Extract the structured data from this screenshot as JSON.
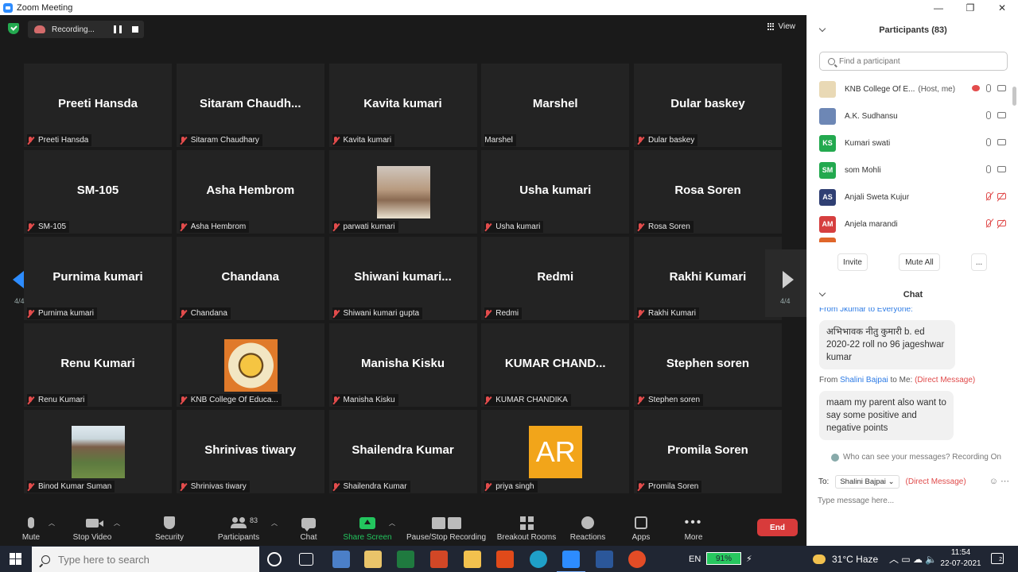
{
  "window": {
    "title": "Zoom Meeting",
    "controls": [
      "—",
      "❐",
      "✕"
    ]
  },
  "meeting": {
    "recording_label": "Recording...",
    "view_label": "View",
    "page_indicator_left": "4/4",
    "page_indicator_right": "4/4",
    "tiles": [
      {
        "big": "Preeti Hansda",
        "name": "Preeti Hansda",
        "muted": true
      },
      {
        "big": "Sitaram  Chaudh...",
        "name": "Sitaram Chaudhary",
        "muted": true
      },
      {
        "big": "Kavita kumari",
        "name": "Kavita kumari",
        "muted": true
      },
      {
        "big": "Marshel",
        "name": "Marshel",
        "muted": false
      },
      {
        "big": "Dular baskey",
        "name": "Dular baskey",
        "muted": true
      },
      {
        "big": "SM-105",
        "name": "SM-105",
        "muted": true
      },
      {
        "big": "Asha Hembrom",
        "name": "Asha Hembrom",
        "muted": true
      },
      {
        "big": "",
        "name": "parwati kumari",
        "muted": true,
        "photo": "boy"
      },
      {
        "big": "Usha kumari",
        "name": "Usha kumari",
        "muted": true
      },
      {
        "big": "Rosa Soren",
        "name": "Rosa Soren",
        "muted": true
      },
      {
        "big": "Purnima kumari",
        "name": "Purnima kumari",
        "muted": true
      },
      {
        "big": "Chandana",
        "name": "Chandana",
        "muted": true
      },
      {
        "big": "Shiwani  kumari...",
        "name": "Shiwani kumari gupta",
        "muted": true
      },
      {
        "big": "Redmi",
        "name": "Redmi",
        "muted": true
      },
      {
        "big": "Rakhi Kumari",
        "name": "Rakhi Kumari",
        "muted": true
      },
      {
        "big": "Renu Kumari",
        "name": "Renu Kumari",
        "muted": true
      },
      {
        "big": "",
        "name": "KNB College Of Educa...",
        "muted": true,
        "photo": "college"
      },
      {
        "big": "Manisha Kisku",
        "name": "Manisha Kisku",
        "muted": true
      },
      {
        "big": "KUMAR  CHAND...",
        "name": "KUMAR CHANDIKA",
        "muted": true
      },
      {
        "big": "Stephen soren",
        "name": "Stephen soren",
        "muted": true
      },
      {
        "big": "",
        "name": "Binod Kumar Suman",
        "muted": true,
        "photo": "man"
      },
      {
        "big": "Shrinivas tiwary",
        "name": "Shrinivas tiwary",
        "muted": true
      },
      {
        "big": "Shailendra Kumar",
        "name": "Shailendra Kumar",
        "muted": true
      },
      {
        "big": "",
        "name": "priya singh",
        "muted": true,
        "photo": "ar",
        "photo_text": "AR"
      },
      {
        "big": "Promila Soren",
        "name": "Promila Soren",
        "muted": true
      }
    ]
  },
  "toolbar": {
    "mute": "Mute",
    "stop_video": "Stop Video",
    "security": "Security",
    "participants": "Participants",
    "participants_count": "83",
    "chat": "Chat",
    "share_screen": "Share Screen",
    "pause_stop_recording": "Pause/Stop Recording",
    "breakout_rooms": "Breakout Rooms",
    "reactions": "Reactions",
    "apps": "Apps",
    "more": "More",
    "end": "End"
  },
  "participants_panel": {
    "title": "Participants (83)",
    "search_placeholder": "Find a participant",
    "rows": [
      {
        "initials": "",
        "color": "#e9d9b5",
        "name": "KNB College Of E...",
        "tag": "(Host, me)",
        "mic": "on",
        "cam": "on",
        "rec": true
      },
      {
        "initials": "",
        "color": "#6d87b5",
        "name": "A.K. Sudhansu",
        "tag": "",
        "mic": "on",
        "cam": "on",
        "rec": false
      },
      {
        "initials": "KS",
        "color": "#23a94f",
        "name": "Kumari swati",
        "tag": "",
        "mic": "on",
        "cam": "on",
        "rec": false
      },
      {
        "initials": "SM",
        "color": "#23a94f",
        "name": "som Mohli",
        "tag": "",
        "mic": "on",
        "cam": "on",
        "rec": false
      },
      {
        "initials": "AS",
        "color": "#2f3f73",
        "name": "Anjali Sweta Kujur",
        "tag": "",
        "mic": "off",
        "cam": "off",
        "rec": false
      },
      {
        "initials": "AM",
        "color": "#d63f3f",
        "name": "Anjela marandi",
        "tag": "",
        "mic": "off",
        "cam": "off",
        "rec": false
      }
    ],
    "invite": "Invite",
    "mute_all": "Mute All",
    "more": "..."
  },
  "chat_panel": {
    "title": "Chat",
    "partial_from": "From Jkumar to Everyone:",
    "msg1": "अभिभावक नीतु कुमारी b. ed 2020-22 roll no 96  jageshwar kumar",
    "from2_prefix": "From",
    "from2_user": "Shalini Bajpai",
    "from2_to": "to Me:",
    "from2_dm": "(Direct Message)",
    "msg2": "maam my parent also want to say some positive and negative points",
    "who_can_see": "Who can see your messages? Recording On",
    "to_label": "To:",
    "to_value": "Shalini Bajpai",
    "to_dm": "(Direct Message)",
    "input_placeholder": "Type message here..."
  },
  "taskbar": {
    "search_placeholder": "Type here to search",
    "lang": "EN",
    "battery": "91%",
    "weather": "31°C  Haze",
    "time": "11:54",
    "date": "22-07-2021",
    "notifications": "2"
  }
}
